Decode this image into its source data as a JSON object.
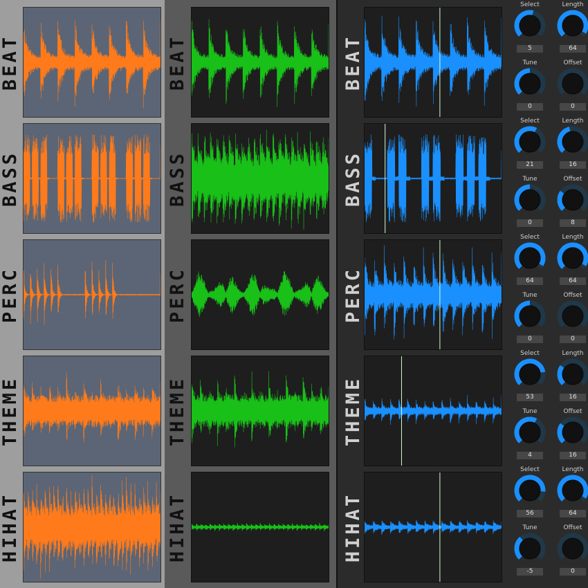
{
  "colors": {
    "panel1_wave": "#ff7a1a",
    "panel2_wave": "#18c018",
    "panel3_wave": "#1a90ff",
    "knob_arc": "#1a90ff",
    "knob_track": "#203848",
    "playhead": "#d8ffd8"
  },
  "tracks": [
    {
      "label": "BEAT"
    },
    {
      "label": "BASS"
    },
    {
      "label": "PERC"
    },
    {
      "label": "THEME"
    },
    {
      "label": "HIHAT"
    }
  ],
  "waveforms": {
    "panel1": [
      {
        "pattern": "beat",
        "envelope": 0.85
      },
      {
        "pattern": "bass",
        "envelope": 0.85
      },
      {
        "pattern": "perc",
        "envelope": 0.75
      },
      {
        "pattern": "theme",
        "envelope": 0.8
      },
      {
        "pattern": "hihat",
        "envelope": 0.95
      }
    ],
    "panel2": [
      {
        "pattern": "beat",
        "envelope": 0.85
      },
      {
        "pattern": "bass2",
        "envelope": 0.95
      },
      {
        "pattern": "perc2",
        "envelope": 0.45
      },
      {
        "pattern": "theme",
        "envelope": 0.85
      },
      {
        "pattern": "hihat2",
        "envelope": 0.08
      }
    ],
    "panel3": [
      {
        "pattern": "beat",
        "envelope": 0.9,
        "playhead": 0.55
      },
      {
        "pattern": "bass3",
        "envelope": 0.9,
        "playhead": 0.15
      },
      {
        "pattern": "perc3",
        "envelope": 0.95,
        "playhead": 0.55
      },
      {
        "pattern": "theme3",
        "envelope": 0.3,
        "playhead": 0.27
      },
      {
        "pattern": "hihat3",
        "envelope": 0.15,
        "playhead": 0.55
      }
    ]
  },
  "knobs": [
    {
      "select": {
        "label": "Select",
        "value": "5",
        "level": 0.55
      },
      "length": {
        "label": "Length",
        "value": "64",
        "level": 0.95
      },
      "tune": {
        "label": "Tune",
        "value": "0",
        "level": 0.5
      },
      "offset": {
        "label": "Offset",
        "value": "0",
        "level": 0.0
      }
    },
    {
      "select": {
        "label": "Select",
        "value": "21",
        "level": 0.6
      },
      "length": {
        "label": "Length",
        "value": "16",
        "level": 0.45
      },
      "tune": {
        "label": "Tune",
        "value": "0",
        "level": 0.5
      },
      "offset": {
        "label": "Offset",
        "value": "8",
        "level": 0.3
      }
    },
    {
      "select": {
        "label": "Select",
        "value": "64",
        "level": 0.95
      },
      "length": {
        "label": "Length",
        "value": "64",
        "level": 0.95
      },
      "tune": {
        "label": "Tune",
        "value": "0",
        "level": 0.5
      },
      "offset": {
        "label": "Offset",
        "value": "0",
        "level": 0.0
      }
    },
    {
      "select": {
        "label": "Select",
        "value": "53",
        "level": 0.8
      },
      "length": {
        "label": "Length",
        "value": "16",
        "level": 0.3
      },
      "tune": {
        "label": "Tune",
        "value": "4",
        "level": 0.6
      },
      "offset": {
        "label": "Offset",
        "value": "16",
        "level": 0.3
      }
    },
    {
      "select": {
        "label": "Select",
        "value": "56",
        "level": 0.85
      },
      "length": {
        "label": "Length",
        "value": "64",
        "level": 0.95
      },
      "tune": {
        "label": "Tune",
        "value": "-5",
        "level": 0.35
      },
      "offset": {
        "label": "Offset",
        "value": "0",
        "level": 0.0
      }
    }
  ]
}
